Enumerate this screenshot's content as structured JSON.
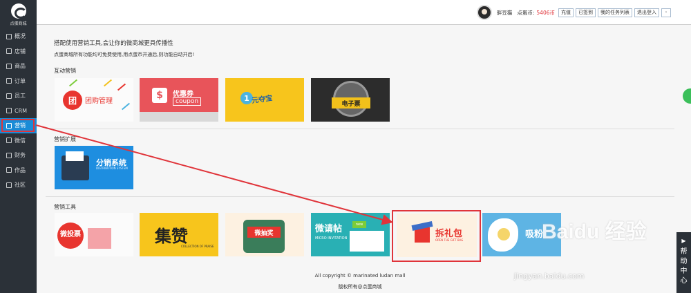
{
  "brand": {
    "logo_text": "点蛋商城"
  },
  "sidebar": {
    "items": [
      {
        "label": "概况",
        "icon": "chart-icon"
      },
      {
        "label": "店铺",
        "icon": "store-icon"
      },
      {
        "label": "商品",
        "icon": "goods-icon"
      },
      {
        "label": "订单",
        "icon": "order-icon"
      },
      {
        "label": "员工",
        "icon": "staff-icon"
      },
      {
        "label": "CRM",
        "icon": "crm-icon"
      },
      {
        "label": "营销",
        "icon": "marketing-icon",
        "active": true
      },
      {
        "label": "微信",
        "icon": "wechat-icon"
      },
      {
        "label": "财务",
        "icon": "finance-icon"
      },
      {
        "label": "作品",
        "icon": "works-icon"
      },
      {
        "label": "社区",
        "icon": "community-icon"
      }
    ]
  },
  "header": {
    "username": "胖豆猫",
    "coins_label": "点蛋币:",
    "coins_value": "5406币",
    "recharge": "充值",
    "checked_in": "已签到",
    "task_list": "我的任务列表",
    "logout": "退出登入"
  },
  "main": {
    "intro_title": "搭配使用营销工具,会让你的微商城更具传播性",
    "intro_sub": "点蛋商城所有功能均可免费使用,用点蛋币开通后,则功能自动开启!",
    "sections": [
      {
        "title": "互动营销",
        "cards": [
          "团购管理",
          "优惠券",
          "1元夺宝",
          "电子票"
        ]
      },
      {
        "title": "营销扩展",
        "cards": [
          "分销系统"
        ]
      },
      {
        "title": "营销工具",
        "cards": [
          "微投票",
          "集赞",
          "微抽奖",
          "微请帖",
          "拆礼包",
          "吸粉"
        ]
      }
    ],
    "card_texts": {
      "tuangou": "团购管理",
      "coupon_badge": "$",
      "coupon": "优惠券",
      "coupon_en": "coupon",
      "yuan_num": "1",
      "yuan": "元夺宝",
      "ticket": "电子票",
      "fenxiao": "分销系统",
      "fenxiao_en": "DISTRIBUTION SYSTEM",
      "toupiao": "微投票",
      "jizan": "集赞",
      "jizan_en": "COLLECTION OF PRAISE",
      "choujiang": "微抽奖",
      "qingtie": "微请帖",
      "qingtie_en": "MICRO INVITATION",
      "qingtie_tag": "new",
      "chailibao": "拆礼包",
      "chailibao_en": "OPEN THE GIFT BAG",
      "xifen": "吸粉"
    }
  },
  "footer": {
    "copyright": "All copyright © marinated ludan mall",
    "rights": "版权所有@点蛋商城"
  },
  "help": {
    "chars": [
      "帮",
      "助",
      "中",
      "心"
    ]
  },
  "watermark": {
    "logo": "Baidu 经验",
    "url": "jingyan.baidu.com"
  },
  "colors": {
    "sidebar_bg": "#2b3138",
    "active_bg": "#1a8bd6",
    "highlight": "#e0343a",
    "coins": "#e0343a"
  }
}
